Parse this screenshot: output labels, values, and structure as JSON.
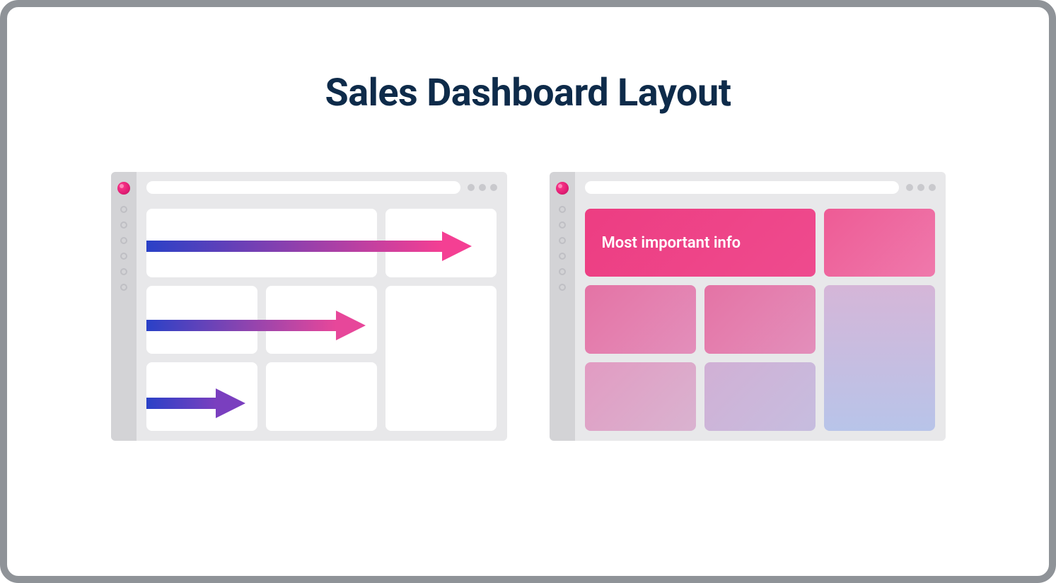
{
  "title": "Sales Dashboard Layout",
  "right_panel": {
    "important_label": "Most important info"
  },
  "colors": {
    "title": "#0e2b4a",
    "frame_border": "#8f9398",
    "sidebar_bg": "#d3d3d6",
    "body_bg": "#e8e8ea",
    "cell_bg": "#ffffff",
    "logo_accent": "#e11d74",
    "gradient_start": "#2a41c7",
    "gradient_end": "#f43f93"
  }
}
